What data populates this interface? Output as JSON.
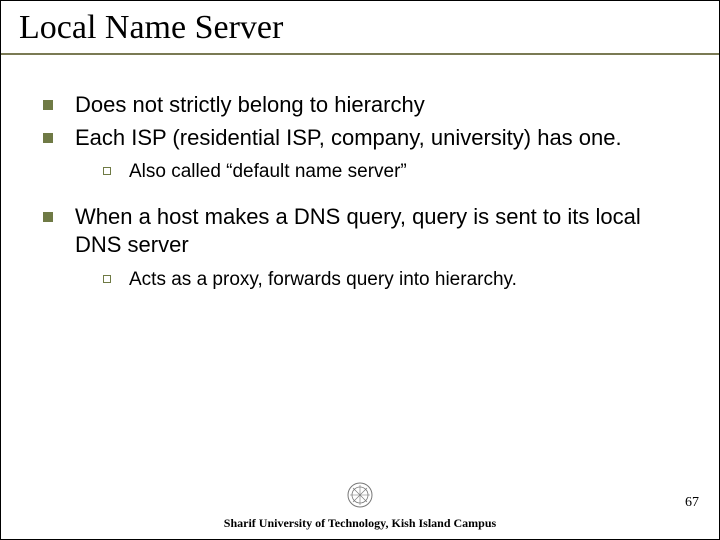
{
  "title": "Local Name Server",
  "bullets": [
    {
      "text": "Does not strictly belong to hierarchy",
      "subs": []
    },
    {
      "text": "Each ISP (residential ISP, company, university) has one.",
      "subs": [
        "Also called “default name server”"
      ]
    },
    {
      "text": "When a host makes a DNS query, query is sent to its local DNS server",
      "subs": [
        "Acts as a proxy, forwards query into hierarchy."
      ]
    }
  ],
  "footer": "Sharif University of Technology, Kish Island Campus",
  "page_number": "67"
}
